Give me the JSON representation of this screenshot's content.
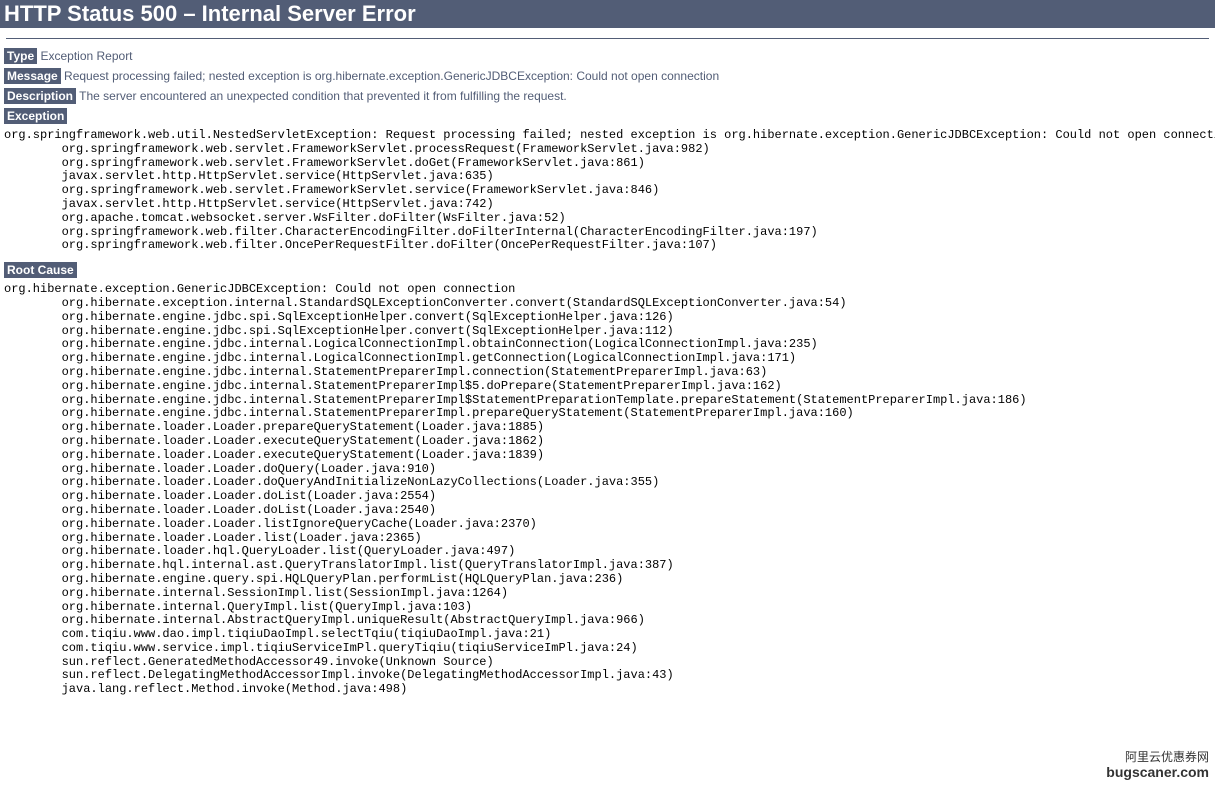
{
  "header": {
    "title": "HTTP Status 500 – Internal Server Error"
  },
  "type": {
    "label": "Type",
    "value": "Exception Report"
  },
  "message": {
    "label": "Message",
    "value": "Request processing failed; nested exception is org.hibernate.exception.GenericJDBCException: Could not open connection"
  },
  "description": {
    "label": "Description",
    "value": "The server encountered an unexpected condition that prevented it from fulfilling the request."
  },
  "exception": {
    "label": "Exception",
    "trace": "org.springframework.web.util.NestedServletException: Request processing failed; nested exception is org.hibernate.exception.GenericJDBCException: Could not open connection\n\torg.springframework.web.servlet.FrameworkServlet.processRequest(FrameworkServlet.java:982)\n\torg.springframework.web.servlet.FrameworkServlet.doGet(FrameworkServlet.java:861)\n\tjavax.servlet.http.HttpServlet.service(HttpServlet.java:635)\n\torg.springframework.web.servlet.FrameworkServlet.service(FrameworkServlet.java:846)\n\tjavax.servlet.http.HttpServlet.service(HttpServlet.java:742)\n\torg.apache.tomcat.websocket.server.WsFilter.doFilter(WsFilter.java:52)\n\torg.springframework.web.filter.CharacterEncodingFilter.doFilterInternal(CharacterEncodingFilter.java:197)\n\torg.springframework.web.filter.OncePerRequestFilter.doFilter(OncePerRequestFilter.java:107)"
  },
  "rootcause": {
    "label": "Root Cause",
    "trace": "org.hibernate.exception.GenericJDBCException: Could not open connection\n\torg.hibernate.exception.internal.StandardSQLExceptionConverter.convert(StandardSQLExceptionConverter.java:54)\n\torg.hibernate.engine.jdbc.spi.SqlExceptionHelper.convert(SqlExceptionHelper.java:126)\n\torg.hibernate.engine.jdbc.spi.SqlExceptionHelper.convert(SqlExceptionHelper.java:112)\n\torg.hibernate.engine.jdbc.internal.LogicalConnectionImpl.obtainConnection(LogicalConnectionImpl.java:235)\n\torg.hibernate.engine.jdbc.internal.LogicalConnectionImpl.getConnection(LogicalConnectionImpl.java:171)\n\torg.hibernate.engine.jdbc.internal.StatementPreparerImpl.connection(StatementPreparerImpl.java:63)\n\torg.hibernate.engine.jdbc.internal.StatementPreparerImpl$5.doPrepare(StatementPreparerImpl.java:162)\n\torg.hibernate.engine.jdbc.internal.StatementPreparerImpl$StatementPreparationTemplate.prepareStatement(StatementPreparerImpl.java:186)\n\torg.hibernate.engine.jdbc.internal.StatementPreparerImpl.prepareQueryStatement(StatementPreparerImpl.java:160)\n\torg.hibernate.loader.Loader.prepareQueryStatement(Loader.java:1885)\n\torg.hibernate.loader.Loader.executeQueryStatement(Loader.java:1862)\n\torg.hibernate.loader.Loader.executeQueryStatement(Loader.java:1839)\n\torg.hibernate.loader.Loader.doQuery(Loader.java:910)\n\torg.hibernate.loader.Loader.doQueryAndInitializeNonLazyCollections(Loader.java:355)\n\torg.hibernate.loader.Loader.doList(Loader.java:2554)\n\torg.hibernate.loader.Loader.doList(Loader.java:2540)\n\torg.hibernate.loader.Loader.listIgnoreQueryCache(Loader.java:2370)\n\torg.hibernate.loader.Loader.list(Loader.java:2365)\n\torg.hibernate.loader.hql.QueryLoader.list(QueryLoader.java:497)\n\torg.hibernate.hql.internal.ast.QueryTranslatorImpl.list(QueryTranslatorImpl.java:387)\n\torg.hibernate.engine.query.spi.HQLQueryPlan.performList(HQLQueryPlan.java:236)\n\torg.hibernate.internal.SessionImpl.list(SessionImpl.java:1264)\n\torg.hibernate.internal.QueryImpl.list(QueryImpl.java:103)\n\torg.hibernate.internal.AbstractQueryImpl.uniqueResult(AbstractQueryImpl.java:966)\n\tcom.tiqiu.www.dao.impl.tiqiuDaoImpl.selectTqiu(tiqiuDaoImpl.java:21)\n\tcom.tiqiu.www.service.impl.tiqiuServiceImPl.queryTiqiu(tiqiuServiceImPl.java:24)\n\tsun.reflect.GeneratedMethodAccessor49.invoke(Unknown Source)\n\tsun.reflect.DelegatingMethodAccessorImpl.invoke(DelegatingMethodAccessorImpl.java:43)\n\tjava.lang.reflect.Method.invoke(Method.java:498)"
  },
  "watermark": {
    "line1": "阿里云优惠券网",
    "line2": "bugscaner.com"
  }
}
